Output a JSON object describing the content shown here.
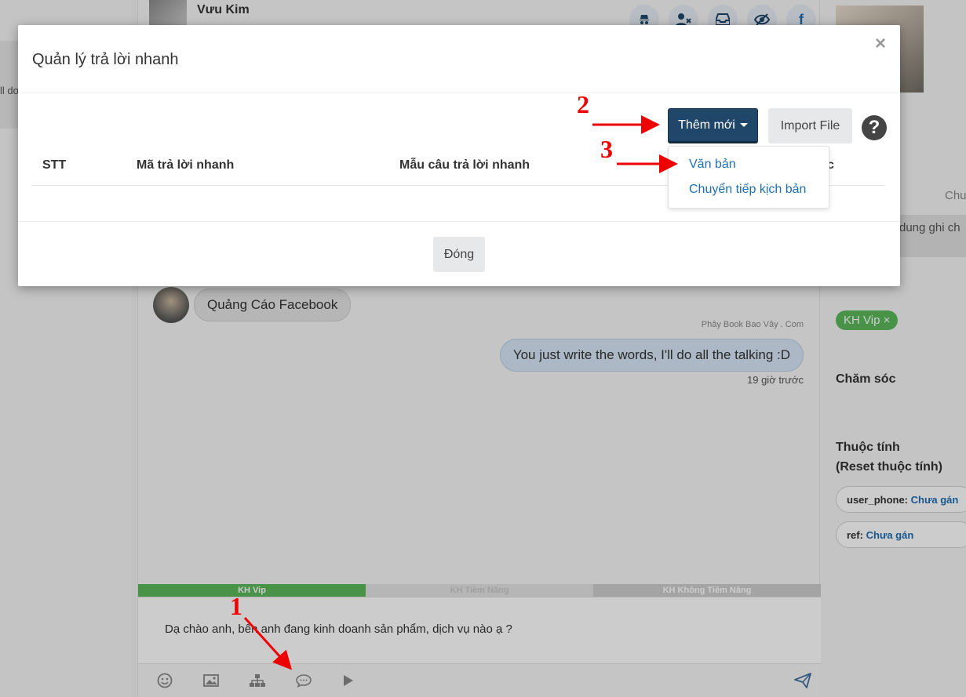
{
  "left": {
    "snippet": "ll do"
  },
  "chat": {
    "contact_name": "Vưu Kim",
    "incoming_message": "Quảng Cáo Facebook",
    "sender_label": "Phây Book Bao Vây . Com",
    "outgoing_message": "You just write the words, I'll do all the talking :D",
    "time": "19 giờ trước",
    "tags": [
      "KH Vip",
      "KH Tiềm Năng",
      "KH Không Tiềm Năng"
    ],
    "composer_text": "Dạ chào anh, bên anh đang kinh doanh sản phẩm, dịch vụ nào ạ ?"
  },
  "right": {
    "chu": "Chu",
    "note": "dung ghi ch",
    "badge": "KH Vip ×",
    "cham_soc": "Chăm sóc",
    "thuoc_tinh": "Thuộc tính",
    "reset": "(Reset thuộc tính)",
    "attrs": [
      {
        "key": "user_phone:",
        "value": "Chưa gán"
      },
      {
        "key": "ref:",
        "value": "Chưa gán"
      }
    ]
  },
  "modal": {
    "title": "Quản lý trả lời nhanh",
    "close_glyph": "×",
    "add_button": "Thêm mới",
    "import_button": "Import File",
    "help_glyph": "?",
    "columns": [
      "STT",
      "Mã trả lời nhanh",
      "Mẫu câu trả lời nhanh",
      "c"
    ],
    "dropdown": [
      "Văn bản",
      "Chuyển tiếp kịch bản"
    ],
    "footer_button": "Đóng"
  },
  "annotations": [
    "1",
    "2",
    "3"
  ],
  "colors": {
    "primary_button": "#20466a",
    "link": "#1f6fb2",
    "vip_green": "#5cb85c",
    "annotation_red": "#e00000"
  }
}
